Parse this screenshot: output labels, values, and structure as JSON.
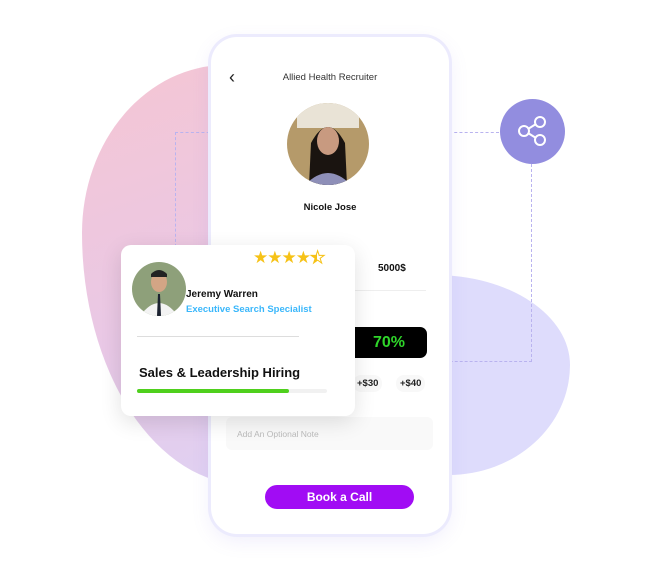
{
  "phone": {
    "title": "Allied Health Recruiter",
    "profile_name": "Nicole Jose",
    "price": "5000$",
    "percent": "70%",
    "tips": [
      "+$30",
      "+$40"
    ],
    "note_placeholder": "Add An Optional Note",
    "book_label": "Book a Call"
  },
  "card": {
    "name": "Jeremy Warren",
    "role": "Executive Search Specialist",
    "rating": 4.5,
    "program": "Sales & Leadership Hiring",
    "progress": 0.8
  },
  "colors": {
    "accent": "#a10cf4",
    "progress": "#4fd01d",
    "role": "#3ab7fb",
    "share": "#928ddf"
  },
  "icons": {
    "back": "chevron-left-icon",
    "share": "share-icon"
  }
}
